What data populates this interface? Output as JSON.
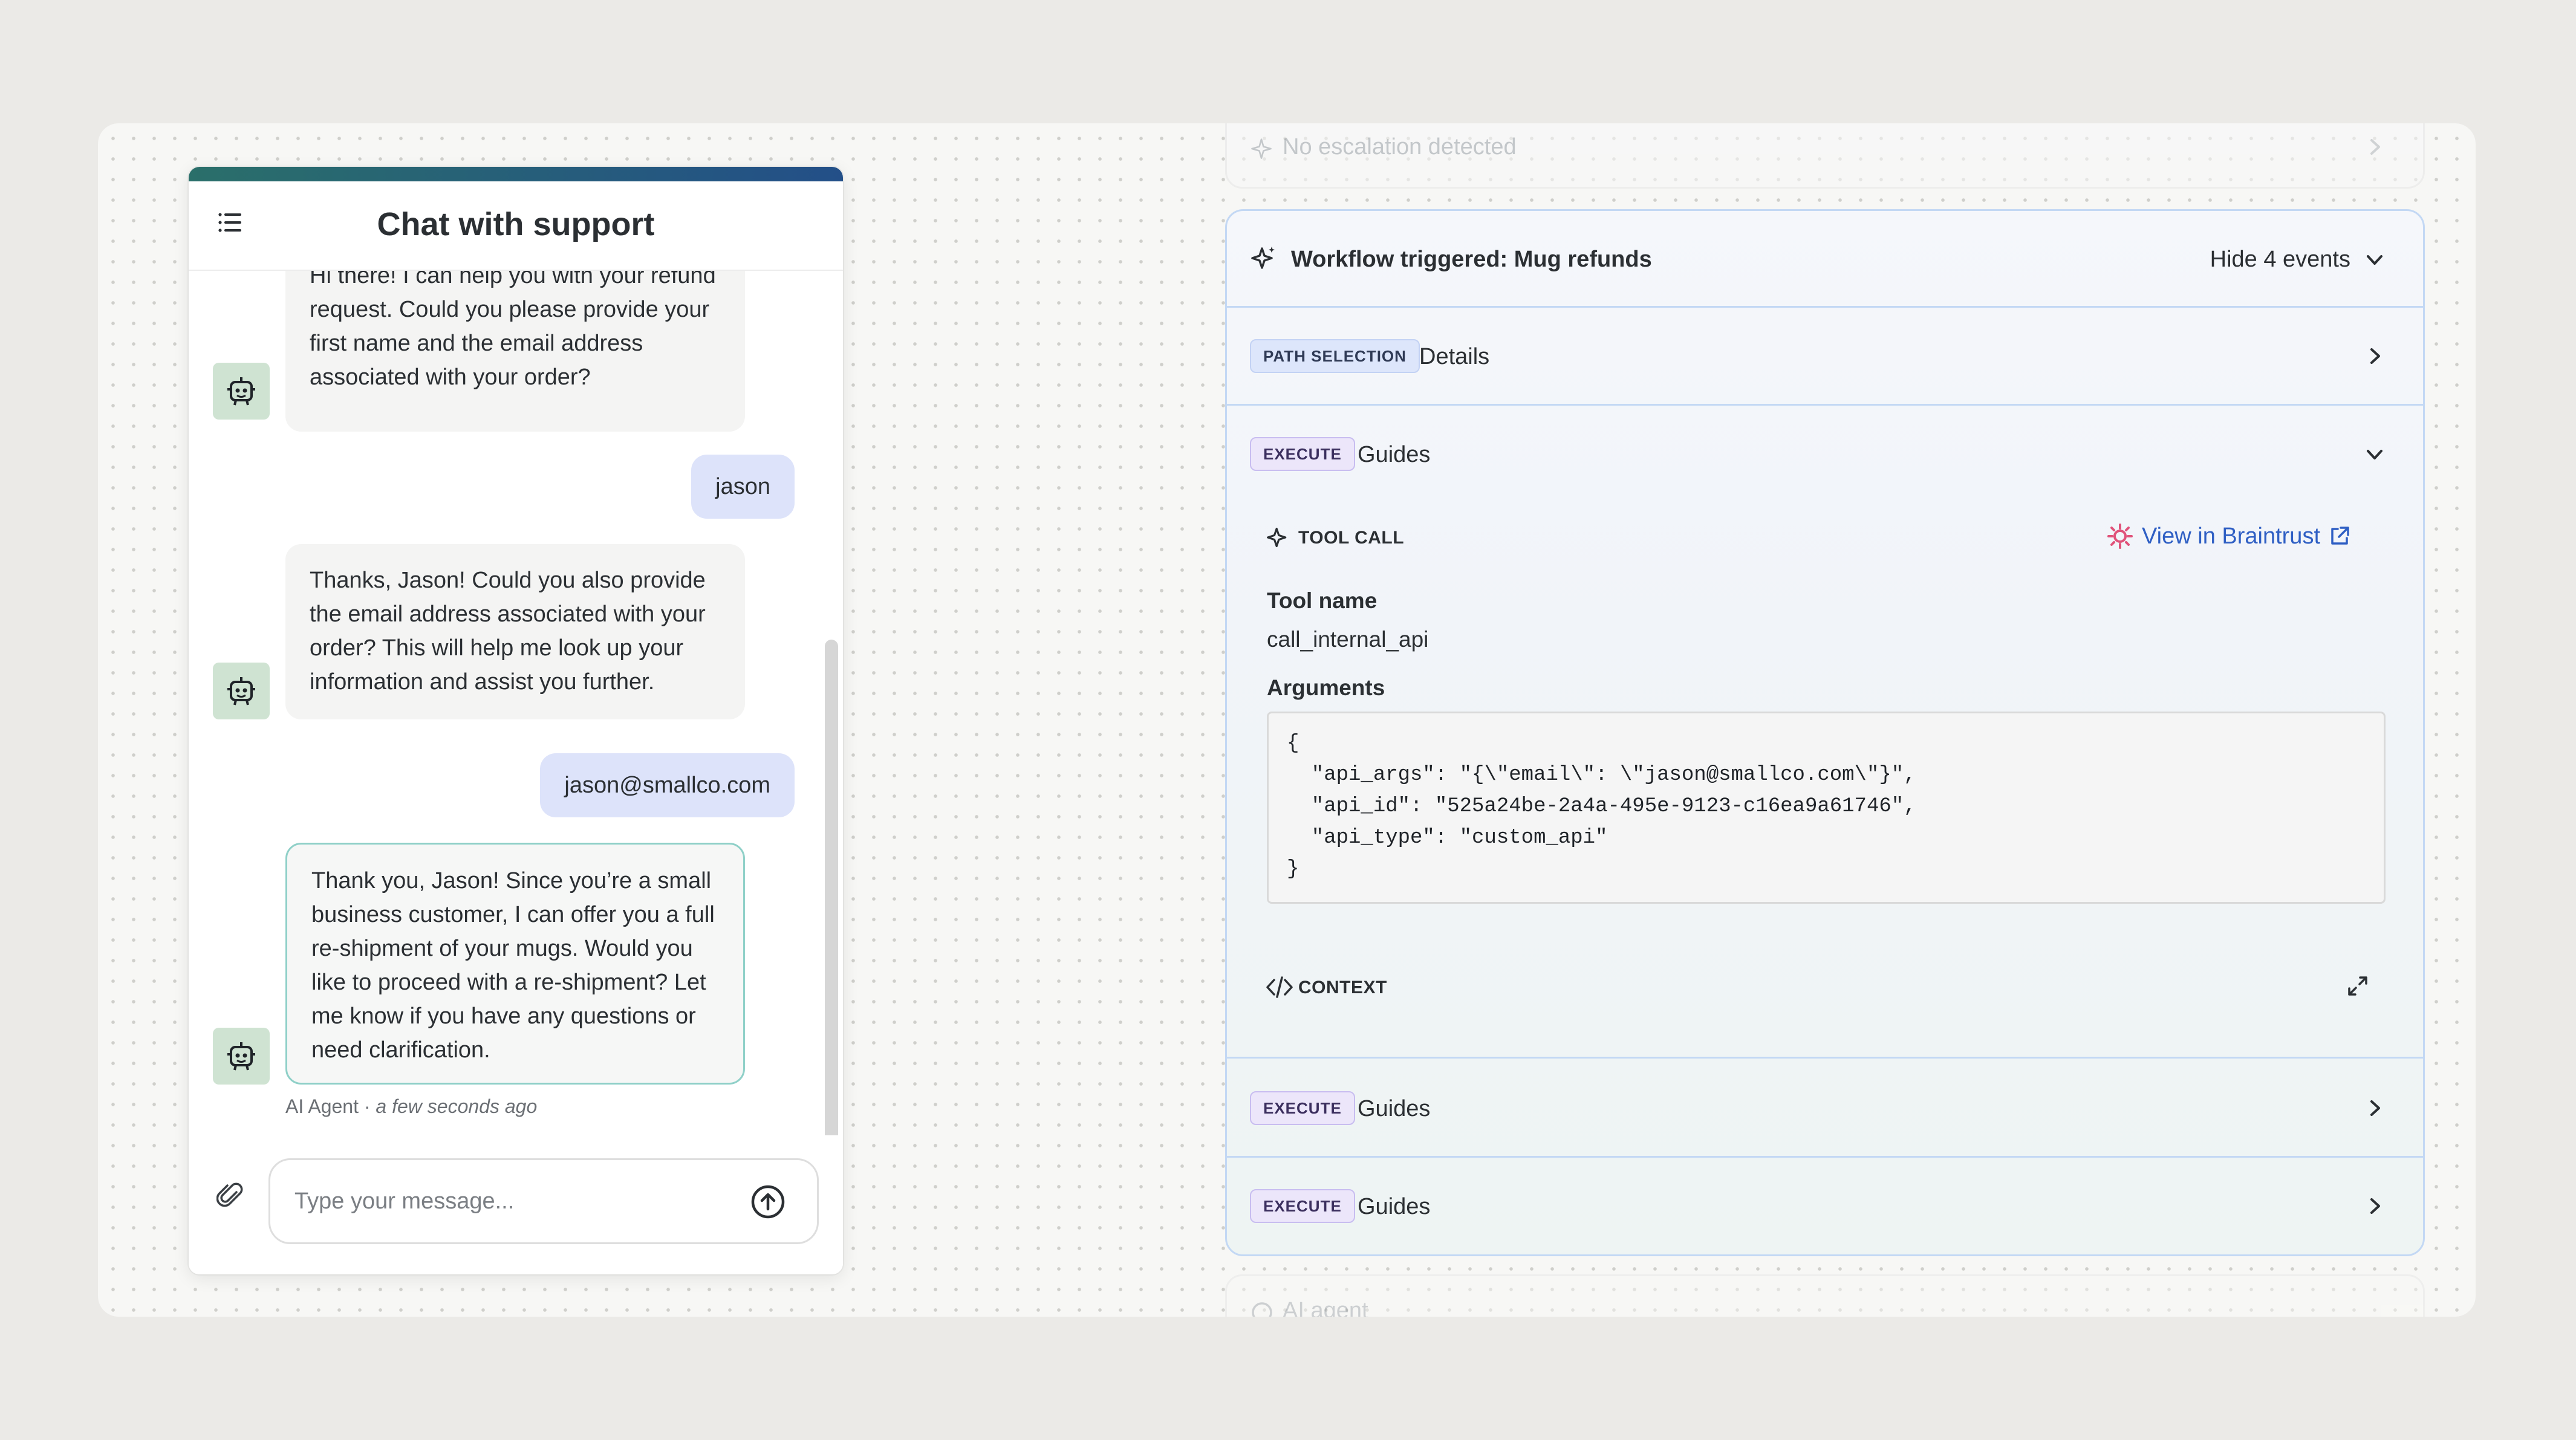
{
  "chat": {
    "title": "Chat with support",
    "messages": [
      {
        "role": "agent",
        "text": "Hi there! I can help you with your refund request. Could you please provide your first name and the email address associated with your order?"
      },
      {
        "role": "user",
        "text": "jason"
      },
      {
        "role": "agent",
        "text": "Thanks, Jason! Could you also provide the email address associated with your order? This will help me look up your information and assist you further."
      },
      {
        "role": "user",
        "text": "jason@smallco.com"
      },
      {
        "role": "agent",
        "text": "Thank you, Jason! Since you’re a small business customer, I can offer you a full re-shipment of your mugs. Would you like to proceed with a re-shipment? Let me know if you have any questions or need clarification."
      }
    ],
    "meta_author": "AI Agent",
    "meta_sep": " · ",
    "meta_time": "a few seconds ago",
    "input_placeholder": "Type your message..."
  },
  "workflow": {
    "top_faded": "No escalation detected",
    "header": {
      "title": "Workflow triggered: Mug refunds",
      "toggle": "Hide 4 events"
    },
    "rows": [
      {
        "badge": "PATH SELECTION",
        "label": "Details"
      },
      {
        "badge": "EXECUTE",
        "label": "Guides"
      },
      {
        "badge": "EXECUTE",
        "label": "Guides"
      },
      {
        "badge": "EXECUTE",
        "label": "Guides"
      }
    ],
    "tool_call": {
      "caption": "TOOL CALL",
      "link": "View in Braintrust",
      "tool_name_label": "Tool name",
      "tool_name": "call_internal_api",
      "arguments_label": "Arguments",
      "arguments": "{\n  \"api_args\": \"{\\\"email\\\": \\\"jason@smallco.com\\\"}\",\n  \"api_id\": \"525a24be-2a4a-495e-9123-c16ea9a61746\",\n  \"api_type\": \"custom_api\"\n}",
      "context_caption": "CONTEXT"
    },
    "bottom_faded": "AI agent"
  },
  "colors": {
    "accent_start": "#2a6f6a",
    "accent_end": "#234f88",
    "link": "#2f5fc4",
    "user_bubble": "#dde3fa",
    "avatar_bg": "#cfe3d2"
  }
}
